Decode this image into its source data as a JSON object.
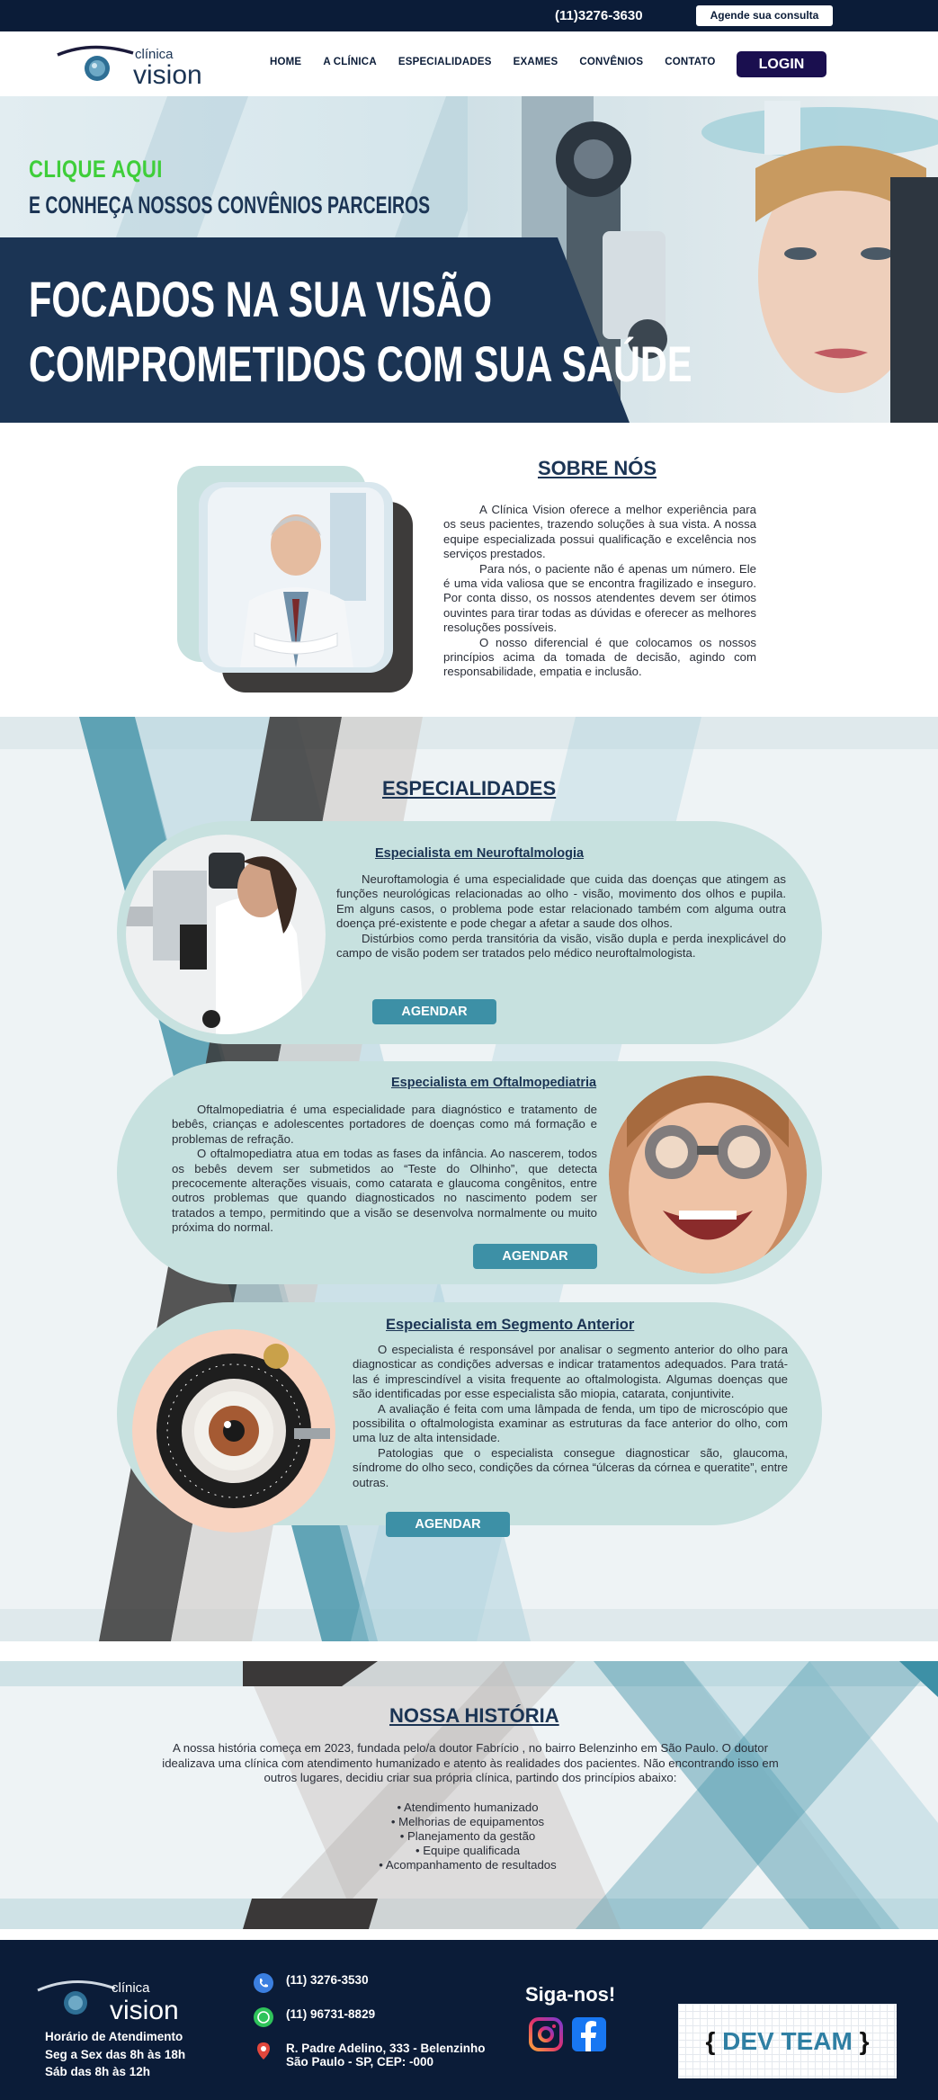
{
  "topbar": {
    "phone": "(11)3276-3630",
    "book_button": "Agende sua consulta"
  },
  "nav": {
    "logo_small": "clínica",
    "logo_big": "vision",
    "links": [
      "HOME",
      "A CLÍNICA",
      "ESPECIALIDADES",
      "EXAMES",
      "CONVÊNIOS",
      "CONTATO"
    ],
    "login": "LOGIN"
  },
  "hero": {
    "cta_1": "CLIQUE AQUI",
    "cta_2": "E CONHEÇA NOSSOS CONVÊNIOS PARCEIROS",
    "headline_1": "FOCADOS NA SUA VISÃO",
    "headline_2": "COMPROMETIDOS COM SUA SAÚDE"
  },
  "sobre": {
    "title": "SOBRE NÓS",
    "paragraphs": [
      "A Clínica Vision oferece a melhor experiência para os seus pacientes, trazendo soluções à sua vista. A nossa equipe especializada possui qualificação e excelência nos serviços prestados.",
      "Para nós, o paciente não é apenas um número. Ele é uma vida valiosa que se encontra fragilizado e inseguro. Por conta disso, os nossos atendentes devem ser ótimos ouvintes para tirar todas as dúvidas e oferecer as melhores resoluções possíveis.",
      "Distúrbios como perda transitória da visão, visão dupla e perda inexplicável do campo de visão podem ser tratados pelo médico neuroftalmologista."
    ],
    "paragraph_4": "O nosso diferencial é que colocamos os nossos princípios acima da tomada de decisão, agindo com responsabilidade, empatia e inclusão."
  },
  "especialidades": {
    "title": "ESPECIALIDADES",
    "agendar": "AGENDAR",
    "neuro": {
      "title": "Especialista em Neuroftalmologia",
      "p1": "Neuroftamologia é uma especialidade que cuida das doenças que atingem as funções neurológicas relacionadas ao olho - visão, movimento dos olhos e pupila. Em alguns casos, o problema pode estar relacionado também com alguma outra doença pré-existente e pode chegar a afetar a saude dos olhos.",
      "p2": "Distúrbios como perda transitória da visão, visão dupla e perda inexplicável do campo de visão podem ser tratados pelo médico neuroftalmologista."
    },
    "oftalmo": {
      "title": "Especialista em Oftalmopediatria",
      "p1": "Oftalmopediatria é uma especialidade para diagnóstico e tratamento de bebês, crianças e adolescentes portadores de doenças como má formação e problemas de refração.",
      "p2": "O oftalmopediatra atua em todas as fases da infância. Ao nascerem, todos os bebês devem ser submetidos ao “Teste do Olhinho”, que detecta precocemente alterações visuais, como catarata e glaucoma congênitos, entre outros problemas que quando diagnosticados no nascimento podem ser tratados a tempo, permitindo que a visão se desenvolva normalmente ou muito próxima do normal."
    },
    "segmento": {
      "title": "Especialista em Segmento Anterior",
      "p1": "O especialista é responsável por analisar o segmento anterior do olho para diagnosticar as condições adversas e indicar tratamentos adequados. Para tratá-las é imprescindível a visita frequente ao oftalmologista. Algumas doenças que são identificadas por esse especialista são miopia, catarata, conjuntivite.",
      "p2": "A avaliação é feita com uma lâmpada de fenda, um tipo de microscópio que possibilita o oftalmologista examinar as estruturas da face anterior do olho, com uma luz de alta intensidade.",
      "p3": "Patologias que o especialista consegue diagnosticar são, glaucoma, síndrome do olho seco, condições da córnea “úlceras da córnea e queratite”, entre outras."
    }
  },
  "historia": {
    "title": "NOSSA HISTÓRIA",
    "text": "A nossa história começa em 2023, fundada pelo/a doutor Fabrício , no bairro Belenzinho em São Paulo. O doutor idealizava uma clínica com atendimento humanizado e atento às realidades dos pacientes. Não encontrando isso em outros lugares, decidiu criar sua própria clínica, partindo dos princípios abaixo:",
    "items": [
      "Atendimento humanizado",
      "Melhorias de equipamentos",
      "Planejamento da gestão",
      "Equipe qualificada",
      "Acompanhamento de resultados"
    ]
  },
  "footer": {
    "logo_small": "clínica",
    "logo_big": "vision",
    "hours_title": "Horário de Atendimento",
    "hours_week": "Seg a Sex das 8h às 18h",
    "hours_sat": "Sáb das 8h às 12h",
    "phone": "(11) 3276-3530",
    "whatsapp": "(11) 96731-8829",
    "address_1": "R. Padre Adelino, 333 - Belenzinho",
    "address_2": "São Paulo - SP, CEP:  -000",
    "follow": "Siga-nos!",
    "dev_team": "DEV TEAM"
  },
  "colors": {
    "navy": "#0b1c38",
    "teal": "#3d90a6",
    "card": "#c7e1df",
    "green": "#3fce3a"
  }
}
